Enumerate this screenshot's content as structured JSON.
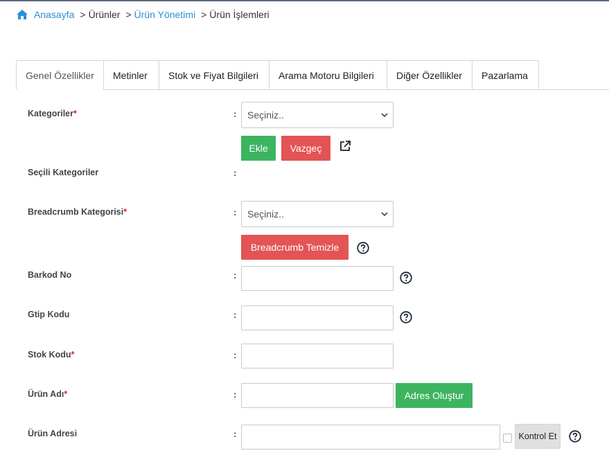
{
  "breadcrumb": {
    "home": "Anasayfa",
    "sep1": ">",
    "item2": "Ürünler",
    "sep2": ">",
    "item3": "Ürün Yönetimi",
    "sep3": ">",
    "item4": "Ürün İşlemleri"
  },
  "tabs": [
    {
      "label": "Genel Özellikler"
    },
    {
      "label": "Metinler"
    },
    {
      "label": "Stok ve Fiyat Bilgileri"
    },
    {
      "label": "Arama Motoru Bilgileri"
    },
    {
      "label": "Diğer Özellikler"
    },
    {
      "label": "Pazarlama"
    }
  ],
  "form": {
    "colon": ":",
    "required_mark": "*",
    "kategoriler": {
      "label": "Kategoriler",
      "placeholder": "Seçiniz..",
      "add": "Ekle",
      "cancel": "Vazgeç"
    },
    "secili": {
      "label": "Seçili Kategoriler"
    },
    "breadcrumb_kat": {
      "label": "Breadcrumb Kategorisi",
      "placeholder": "Seçiniz..",
      "clear": "Breadcrumb Temizle"
    },
    "barkod": {
      "label": "Barkod No",
      "value": ""
    },
    "gtip": {
      "label": "Gtip Kodu",
      "value": ""
    },
    "stok": {
      "label": "Stok Kodu",
      "value": ""
    },
    "urun_adi": {
      "label": "Ürün Adı",
      "value": "",
      "button": "Adres Oluştur"
    },
    "urun_adresi": {
      "label": "Ürün Adresi",
      "value": "",
      "button": "Kontrol Et"
    }
  },
  "colors": {
    "link": "#2b8fd6",
    "green": "#3db460",
    "red": "#e35454",
    "help": "#1e2a3a"
  },
  "icons": [
    "home-icon",
    "chevron-down-icon",
    "external-link-icon",
    "help-icon"
  ]
}
